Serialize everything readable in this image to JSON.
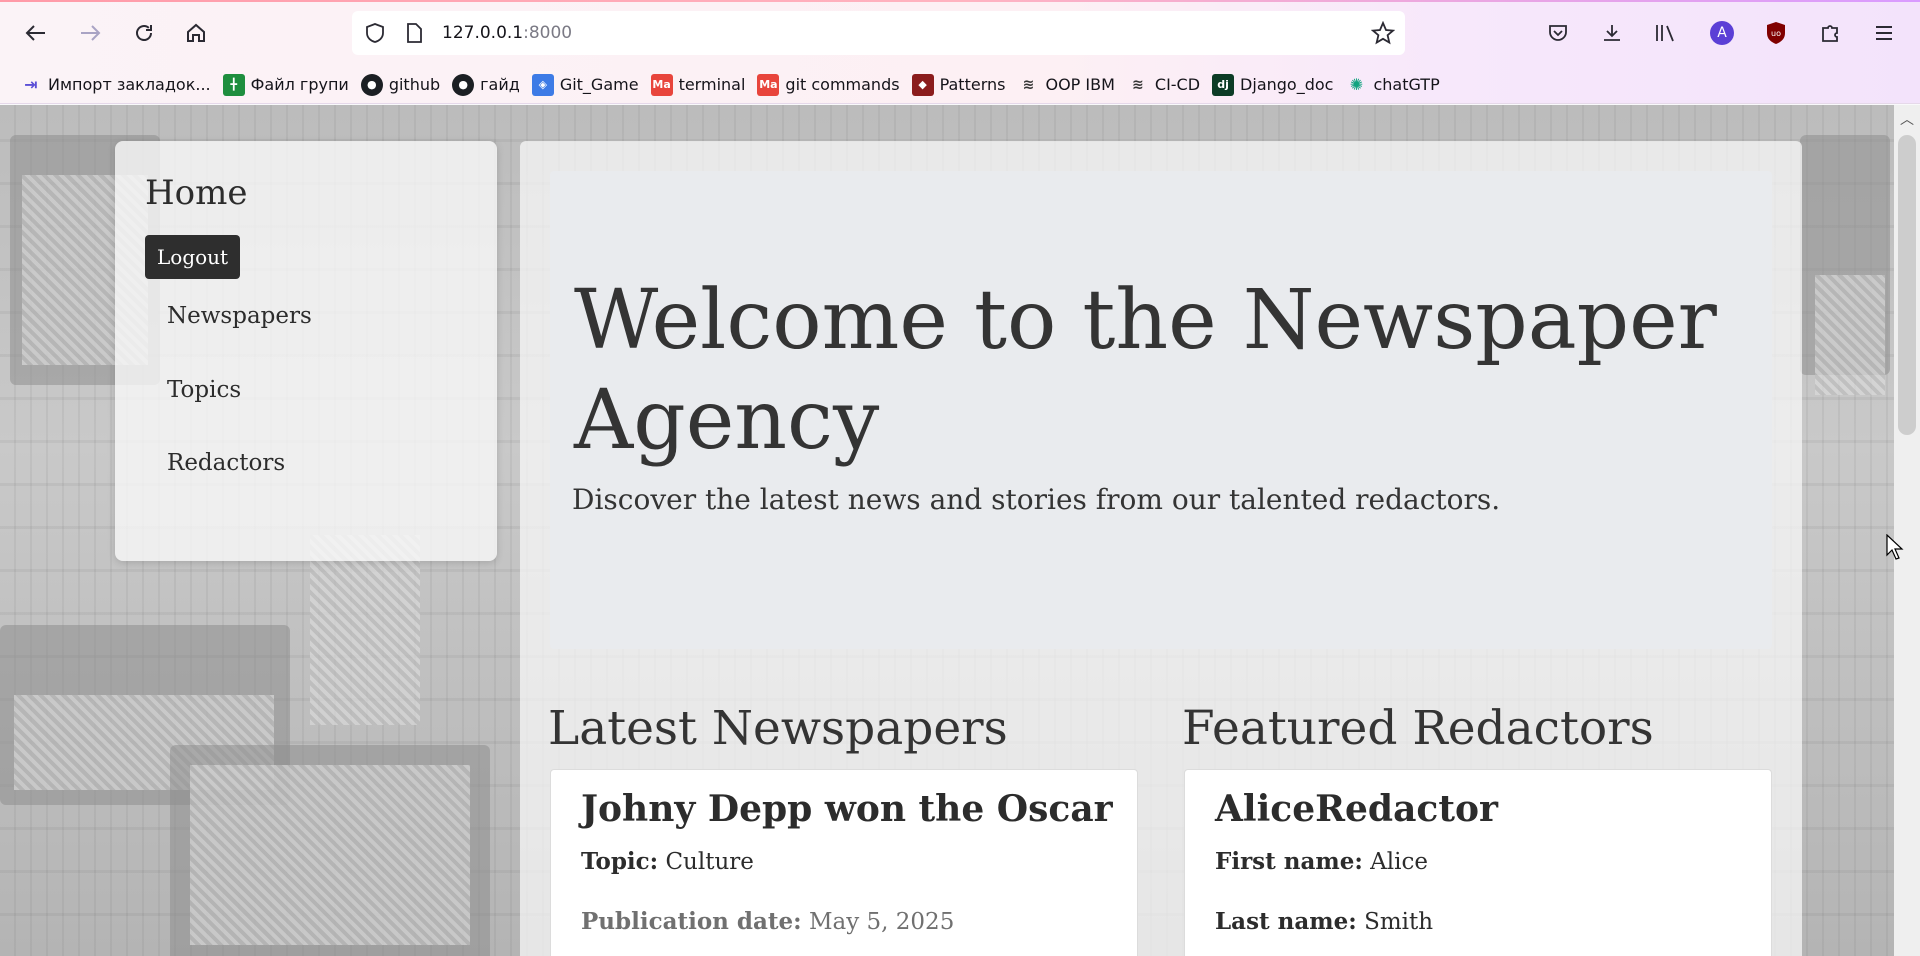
{
  "browser": {
    "url_host": "127.0.0.1",
    "url_port": ":8000",
    "bookmarks": [
      {
        "label": "Импорт закладок...",
        "icon": "import-icon",
        "color": "#5b4fd6"
      },
      {
        "label": "Файл групи",
        "icon": "sheets-icon",
        "color": "#1e8e3e"
      },
      {
        "label": "github",
        "icon": "github-icon",
        "color": "#1b1f23"
      },
      {
        "label": "гайд",
        "icon": "github-icon",
        "color": "#1b1f23"
      },
      {
        "label": "Git_Game",
        "icon": "git-game-icon",
        "color": "#3d7be6"
      },
      {
        "label": "terminal",
        "icon": "ma-icon",
        "color": "#e8453c"
      },
      {
        "label": "git commands",
        "icon": "ma-icon",
        "color": "#e8453c"
      },
      {
        "label": "Patterns",
        "icon": "patterns-icon",
        "color": "#8b1c1c"
      },
      {
        "label": "OOP IBM",
        "icon": "ibm-icon",
        "color": "#333333"
      },
      {
        "label": "CI-CD",
        "icon": "ibm-icon",
        "color": "#333333"
      },
      {
        "label": "Django_doc",
        "icon": "django-icon",
        "color": "#0c3c26"
      },
      {
        "label": "chatGTP",
        "icon": "chatgpt-icon",
        "color": "#10a37f"
      }
    ]
  },
  "sidebar": {
    "title": "Home",
    "logout_label": "Logout",
    "links": [
      "Newspapers",
      "Topics",
      "Redactors"
    ]
  },
  "hero": {
    "title": "Welcome to the Newspaper Agency",
    "subtitle": "Discover the latest news and stories from our talented redactors."
  },
  "latest": {
    "heading": "Latest Newspapers",
    "card": {
      "title": "Johny Depp won the Oscar",
      "topic_label": "Topic:",
      "topic_value": "Culture",
      "date_label": "Publication date:",
      "date_value": "May 5, 2025"
    }
  },
  "featured": {
    "heading": "Featured Redactors",
    "card": {
      "title": "AliceRedactor",
      "first_label": "First name:",
      "first_value": "Alice",
      "last_label": "Last name:",
      "last_value": "Smith"
    }
  }
}
